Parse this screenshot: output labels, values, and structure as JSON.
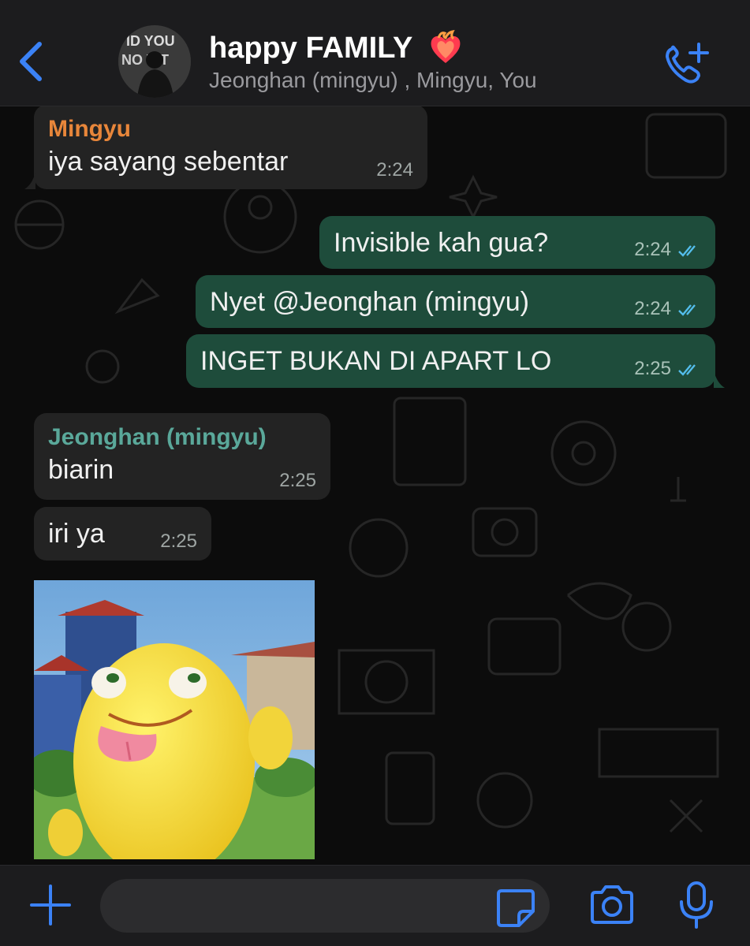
{
  "header": {
    "back_icon": "chevron-left-icon",
    "avatar_icon": "group-avatar",
    "avatar_text": "ID YOU NO WT",
    "title": "happy FAMILY",
    "title_emoji_icon": "heart-on-fire-icon",
    "subtitle": "Jeonghan (mingyu) , Mingyu, You",
    "call_icon": "add-call-icon"
  },
  "messages": [
    {
      "direction": "in",
      "sender": "Mingyu",
      "sender_color": "#e8863a",
      "text": "iya sayang sebentar",
      "time": "2:24"
    },
    {
      "direction": "out",
      "text": "Invisible kah gua?",
      "time": "2:24",
      "status": "read"
    },
    {
      "direction": "out",
      "text": "Nyet @Jeonghan (mingyu)",
      "time": "2:24",
      "status": "read"
    },
    {
      "direction": "out",
      "text": "INGET BUKAN DI APART LO",
      "time": "2:25",
      "status": "read"
    },
    {
      "direction": "in",
      "sender": "Jeonghan (mingyu)",
      "sender_color": "#5aa89a",
      "text": "biarin",
      "time": "2:25"
    },
    {
      "direction": "in",
      "text": "iri ya",
      "time": "2:25"
    },
    {
      "direction": "in",
      "type": "sticker",
      "sticker": "yellow-creature-tongue-sticker"
    }
  ],
  "input_bar": {
    "placeholder": "",
    "value": "",
    "icons": [
      "plus-icon",
      "sticker-icon",
      "camera-icon",
      "microphone-icon"
    ]
  },
  "colors": {
    "accent": "#3b82f6",
    "incoming_bubble": "#232323",
    "outgoing_bubble": "#1e4c3b",
    "read_ticks": "#53bdeb"
  }
}
